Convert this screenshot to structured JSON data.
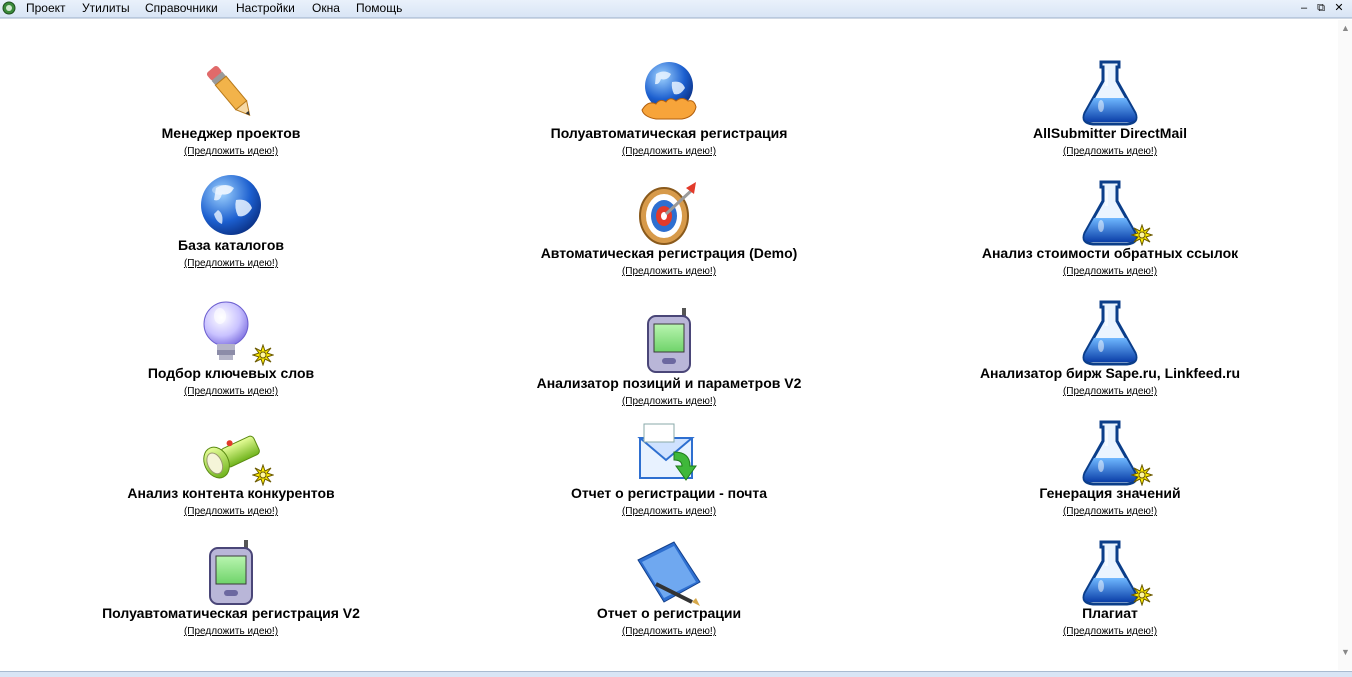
{
  "menu": {
    "items": [
      "Проект",
      "Утилиты",
      "Справочники",
      "Настройки",
      "Окна",
      "Помощь"
    ]
  },
  "window_controls": {
    "minimize": "‒",
    "restore": "⧉",
    "close": "✕"
  },
  "idea_link": "(Предложить идею!)",
  "tiles": [
    {
      "title": "Менеджер проектов",
      "icon": "pencil-icon",
      "badge": false
    },
    {
      "title": "Полуавтоматическая регистрация",
      "icon": "globe-hand-icon",
      "badge": false
    },
    {
      "title": "AllSubmitter DirectMail",
      "icon": "flask-icon",
      "badge": false
    },
    {
      "title": "База каталогов",
      "icon": "globe-icon",
      "badge": false
    },
    {
      "title": "Автоматическая регистрация (Demo)",
      "icon": "target-icon",
      "badge": false
    },
    {
      "title": "Анализ стоимости обратных ссылок",
      "icon": "flask-icon",
      "badge": true
    },
    {
      "title": "Подбор ключевых слов",
      "icon": "lightbulb-icon",
      "badge": true
    },
    {
      "title": "Анализатор позиций и параметров V2",
      "icon": "pda-icon",
      "badge": false
    },
    {
      "title": "Анализатор бирж Sape.ru, Linkfeed.ru",
      "icon": "flask-icon",
      "badge": false
    },
    {
      "title": "Анализ контента конкурентов",
      "icon": "flashlight-icon",
      "badge": true
    },
    {
      "title": "Отчет о регистрации - почта",
      "icon": "envelope-icon",
      "badge": false
    },
    {
      "title": "Генерация значений",
      "icon": "flask-icon",
      "badge": true
    },
    {
      "title": "Полуавтоматическая регистрация V2",
      "icon": "pda-icon",
      "badge": false
    },
    {
      "title": "Отчет о регистрации",
      "icon": "book-pen-icon",
      "badge": false
    },
    {
      "title": "Плагиат",
      "icon": "flask-icon",
      "badge": true
    }
  ],
  "colors": {
    "menubar": "#d9e5f5",
    "flask_liquid": "#1e6fd9",
    "badge_yellow": "#ffee00"
  }
}
